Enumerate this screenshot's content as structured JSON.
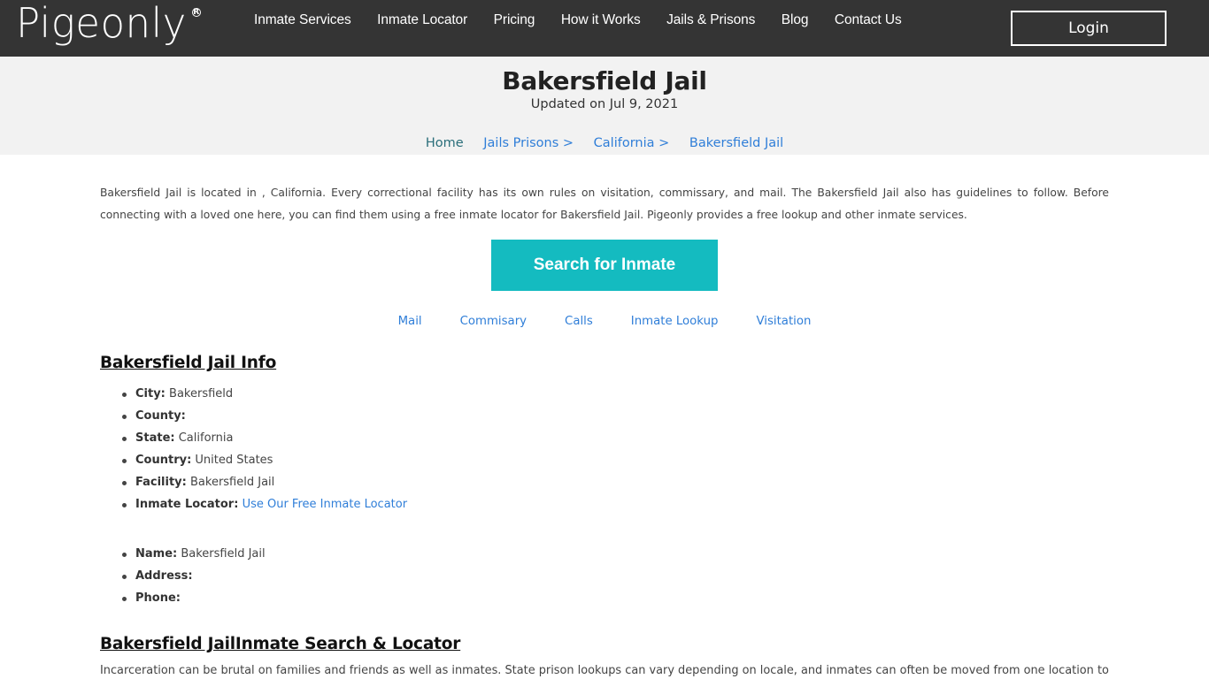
{
  "brand": {
    "name": "Pigeonly",
    "registered_mark": "R"
  },
  "nav": {
    "items": [
      {
        "label": "Inmate Services"
      },
      {
        "label": "Inmate Locator"
      },
      {
        "label": "Pricing"
      },
      {
        "label": "How it Works"
      },
      {
        "label": "Jails & Prisons"
      },
      {
        "label": "Blog"
      },
      {
        "label": "Contact Us"
      }
    ],
    "login_label": "Login"
  },
  "hero": {
    "title": "Bakersfield Jail",
    "updated": "Updated on Jul 9, 2021",
    "breadcrumb": [
      {
        "label": "Home"
      },
      {
        "label": "Jails Prisons >"
      },
      {
        "label": "California >"
      },
      {
        "label": "Bakersfield Jail"
      }
    ]
  },
  "intro": {
    "text": "Bakersfield Jail is located in , California. Every correctional facility has its own rules on visitation, commissary, and mail. The Bakersfield Jail also has guidelines to follow. Before connecting with a loved one here, you can find them using a free inmate locator for Bakersfield Jail. Pigeonly provides a free lookup and other inmate services."
  },
  "search_button": {
    "label": "Search for Inmate",
    "color": "#14bbc0"
  },
  "sublinks": [
    {
      "label": "Mail"
    },
    {
      "label": "Commisary"
    },
    {
      "label": "Calls"
    },
    {
      "label": "Inmate Lookup"
    },
    {
      "label": "Visitation"
    }
  ],
  "info_section": {
    "title": "Bakersfield Jail Info",
    "items": [
      {
        "key": "City:",
        "value": " Bakersfield"
      },
      {
        "key": "County:",
        "value": ""
      },
      {
        "key": "State:",
        "value": " California"
      },
      {
        "key": "Country:",
        "value": " United States"
      },
      {
        "key": "Facility:",
        "value": " Bakersfield Jail"
      },
      {
        "key": "Inmate Locator:",
        "link": "Use Our Free Inmate Locator"
      }
    ],
    "contact_items": [
      {
        "key": "Name:",
        "value": " Bakersfield Jail"
      },
      {
        "key": "Address:",
        "value": ""
      },
      {
        "key": "Phone:",
        "value": ""
      }
    ]
  },
  "search_section": {
    "title": "Bakersfield JailInmate Search & Locator",
    "text": "Incarceration can be brutal on families and friends as well as inmates. State prison lookups can vary depending on locale, and inmates can often be moved from one location to another"
  }
}
